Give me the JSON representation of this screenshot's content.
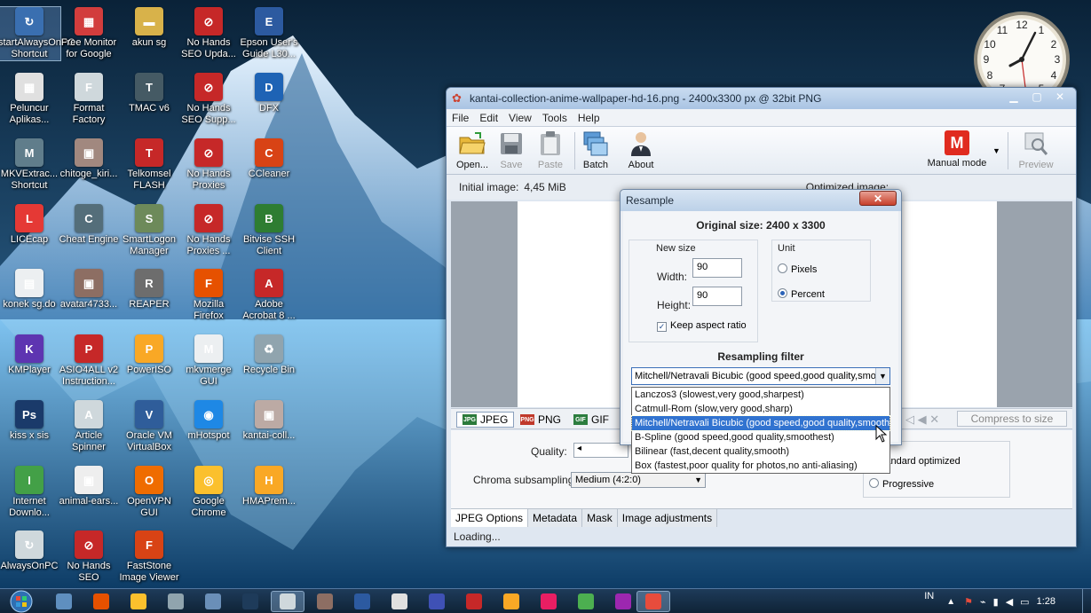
{
  "desktop": {
    "icons": [
      {
        "label": "startAlwaysOnPC Shortcut",
        "color": "#3a6fb0",
        "glyph": "↻"
      },
      {
        "label": "Free Monitor for Google",
        "color": "#d23d3d",
        "glyph": "▦"
      },
      {
        "label": "akun sg",
        "color": "#d8b24a",
        "glyph": "▬"
      },
      {
        "label": "No Hands SEO Upda...",
        "color": "#c62828",
        "glyph": "⊘"
      },
      {
        "label": "Epson User's Guide L30...",
        "color": "#2c5aa0",
        "glyph": "E"
      },
      {
        "label": "Peluncur Aplikas...",
        "color": "#e0e0e0",
        "glyph": "▦"
      },
      {
        "label": "Format Factory",
        "color": "#cfd8dc",
        "glyph": "F"
      },
      {
        "label": "TMAC v6",
        "color": "#455a64",
        "glyph": "T"
      },
      {
        "label": "No Hands SEO Supp...",
        "color": "#c62828",
        "glyph": "⊘"
      },
      {
        "label": "DFX",
        "color": "#1e63b5",
        "glyph": "D"
      },
      {
        "label": "MKVExtrac... Shortcut",
        "color": "#607d8b",
        "glyph": "M"
      },
      {
        "label": "chitoge_kiri...",
        "color": "#a1887f",
        "glyph": "▣"
      },
      {
        "label": "Telkomsel FLASH",
        "color": "#c62828",
        "glyph": "T"
      },
      {
        "label": "No Hands Proxies",
        "color": "#c62828",
        "glyph": "⊘"
      },
      {
        "label": "CCleaner",
        "color": "#d84315",
        "glyph": "C"
      },
      {
        "label": "LICEcap",
        "color": "#e53935",
        "glyph": "L"
      },
      {
        "label": "Cheat Engine",
        "color": "#546e7a",
        "glyph": "C"
      },
      {
        "label": "SmartLogon Manager",
        "color": "#6d8a5a",
        "glyph": "S"
      },
      {
        "label": "No Hands Proxies ...",
        "color": "#c62828",
        "glyph": "⊘"
      },
      {
        "label": "Bitvise SSH Client",
        "color": "#2e7d32",
        "glyph": "B"
      },
      {
        "label": "konek sg.do",
        "color": "#eceff1",
        "glyph": "▤"
      },
      {
        "label": "avatar4733...",
        "color": "#8d6e63",
        "glyph": "▣"
      },
      {
        "label": "REAPER",
        "color": "#6d6d6d",
        "glyph": "R"
      },
      {
        "label": "Mozilla Firefox",
        "color": "#e65100",
        "glyph": "F"
      },
      {
        "label": "Adobe Acrobat 8 ...",
        "color": "#c62828",
        "glyph": "A"
      },
      {
        "label": "KMPlayer",
        "color": "#5e35b1",
        "glyph": "K"
      },
      {
        "label": "ASIO4ALL v2 Instruction...",
        "color": "#c62828",
        "glyph": "P"
      },
      {
        "label": "PowerISO",
        "color": "#f9a825",
        "glyph": "P"
      },
      {
        "label": "mkvmerge GUI",
        "color": "#eceff1",
        "glyph": "M"
      },
      {
        "label": "Recycle Bin",
        "color": "#90a4ae",
        "glyph": "♻"
      },
      {
        "label": "kiss x sis",
        "color": "#1a3a6a",
        "glyph": "Ps"
      },
      {
        "label": "Article Spinner",
        "color": "#cfd8dc",
        "glyph": "A"
      },
      {
        "label": "Oracle VM VirtualBox",
        "color": "#2f5d9a",
        "glyph": "V"
      },
      {
        "label": "mHotspot",
        "color": "#1e88e5",
        "glyph": "◉"
      },
      {
        "label": "kantai-coll...",
        "color": "#bcaaa4",
        "glyph": "▣"
      },
      {
        "label": "Internet Downlo...",
        "color": "#43a047",
        "glyph": "I"
      },
      {
        "label": "animal-ears...",
        "color": "#eeeeee",
        "glyph": "▣"
      },
      {
        "label": "OpenVPN GUI",
        "color": "#ef6c00",
        "glyph": "O"
      },
      {
        "label": "Google Chrome",
        "color": "#fbc02d",
        "glyph": "◎"
      },
      {
        "label": "HMAPrem...",
        "color": "#f9a825",
        "glyph": "H"
      },
      {
        "label": "AlwaysOnPC",
        "color": "#cfd8dc",
        "glyph": "↻"
      },
      {
        "label": "No Hands SEO",
        "color": "#c62828",
        "glyph": "⊘"
      },
      {
        "label": "FastStone Image Viewer",
        "color": "#d84315",
        "glyph": "F"
      }
    ]
  },
  "window": {
    "title": "kantai-collection-anime-wallpaper-hd-16.png - 2400x3300 px @ 32bit PNG",
    "menu": [
      "File",
      "Edit",
      "View",
      "Tools",
      "Help"
    ],
    "toolbar": {
      "open": "Open...",
      "save": "Save",
      "paste": "Paste",
      "batch": "Batch",
      "about": "About",
      "mode": "Manual mode",
      "mode_letter": "M",
      "preview": "Preview"
    },
    "initial_label": "Initial image:",
    "initial_size": "4,45 MiB",
    "optimized_label": "Optimized image:",
    "formats": [
      "JPEG",
      "PNG",
      "GIF"
    ],
    "compress_label": "Compress to size",
    "quality_label": "Quality:",
    "chroma_label": "Chroma subsampling:",
    "chroma_value": "Medium (4:2:0)",
    "enc_std": "Standard optimized",
    "enc_prog": "Progressive",
    "tabs": [
      "JPEG Options",
      "Metadata",
      "Mask",
      "Image adjustments"
    ],
    "status": "Loading..."
  },
  "dialog": {
    "title": "Resample",
    "close": "✕",
    "original_size": "Original size: 2400 x 3300",
    "new_size_label": "New size",
    "width_label": "Width:",
    "width_value": "90",
    "height_label": "Height:",
    "height_value": "90",
    "keep_aspect": "Keep aspect ratio",
    "unit_label": "Unit",
    "unit_pixels": "Pixels",
    "unit_percent": "Percent",
    "filter_label": "Resampling filter",
    "filter_selected": "Mitchell/Netravali Bicubic (good speed,good quality,smoothest)",
    "filter_options": [
      "Lanczos3 (slowest,very good,sharpest)",
      "Catmull-Rom (slow,very good,sharp)",
      "Mitchell/Netravali Bicubic (good speed,good quality,smoothest)",
      "B-Spline (good speed,good quality,smoothest)",
      "Bilinear (fast,decent quality,smooth)",
      "Box (fastest,poor quality for photos,no anti-aliasing)"
    ]
  },
  "taskbar": {
    "tray_lang": "IN",
    "time": "1:28"
  },
  "colors": {
    "accent": "#3173d0",
    "mode_red": "#e02b1f"
  }
}
